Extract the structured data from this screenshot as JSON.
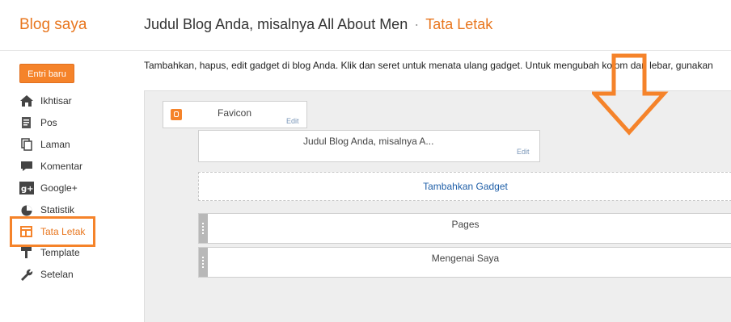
{
  "app": {
    "brand": "Blog saya",
    "blog_title": "Judul Blog Anda, misalnya All About Men",
    "separator": "·",
    "section": "Tata Letak",
    "accent_color": "#e8761e"
  },
  "sidebar": {
    "new_post_label": "Entri baru",
    "items": [
      {
        "label": "Ikhtisar",
        "icon": "home-icon"
      },
      {
        "label": "Pos",
        "icon": "posts-icon"
      },
      {
        "label": "Laman",
        "icon": "pages-icon"
      },
      {
        "label": "Komentar",
        "icon": "comment-icon"
      },
      {
        "label": "Google+",
        "icon": "google-plus-icon"
      },
      {
        "label": "Statistik",
        "icon": "stats-icon"
      },
      {
        "label": "Tata Letak",
        "icon": "layout-icon",
        "active": true
      },
      {
        "label": "Template",
        "icon": "template-icon"
      },
      {
        "label": "Setelan",
        "icon": "wrench-icon"
      }
    ]
  },
  "main": {
    "instruction": "Tambahkan, hapus, edit gadget di blog Anda. Klik dan seret untuk menata ulang gadget. Untuk mengubah kolom dan lebar, gunakan",
    "gadgets": {
      "favicon": {
        "title": "Favicon",
        "edit": "Edit"
      },
      "header": {
        "title": "Judul Blog Anda, misalnya A...",
        "edit": "Edit"
      },
      "add_gadget": "Tambahkan Gadget",
      "pages": "Pages",
      "about": "Mengenai Saya"
    }
  }
}
